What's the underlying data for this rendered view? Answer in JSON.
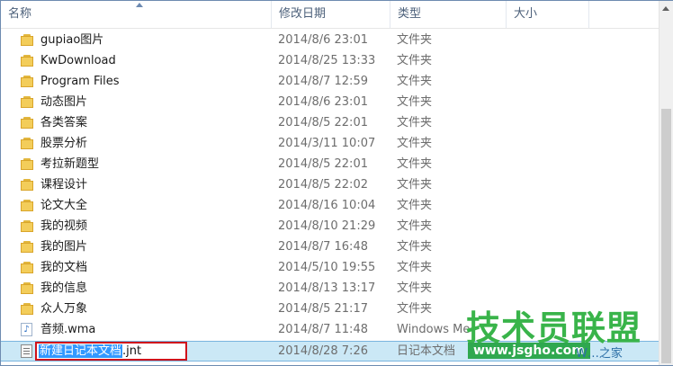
{
  "columns": {
    "name": "名称",
    "date": "修改日期",
    "type": "类型",
    "size": "大小"
  },
  "files": [
    {
      "icon": "folder",
      "name": "gupiao图片",
      "date": "2014/8/6 23:01",
      "type": "文件夹"
    },
    {
      "icon": "folder",
      "name": "KwDownload",
      "date": "2014/8/25 13:33",
      "type": "文件夹"
    },
    {
      "icon": "folder",
      "name": "Program Files",
      "date": "2014/8/7 12:59",
      "type": "文件夹"
    },
    {
      "icon": "folder",
      "name": "动态图片",
      "date": "2014/8/6 23:01",
      "type": "文件夹"
    },
    {
      "icon": "folder",
      "name": "各类答案",
      "date": "2014/8/5 22:01",
      "type": "文件夹"
    },
    {
      "icon": "folder",
      "name": "股票分析",
      "date": "2014/3/11 10:07",
      "type": "文件夹"
    },
    {
      "icon": "folder",
      "name": "考拉新题型",
      "date": "2014/8/5 22:01",
      "type": "文件夹"
    },
    {
      "icon": "folder",
      "name": "课程设计",
      "date": "2014/8/5 22:02",
      "type": "文件夹"
    },
    {
      "icon": "folder",
      "name": "论文大全",
      "date": "2014/8/16 10:04",
      "type": "文件夹"
    },
    {
      "icon": "folder",
      "name": "我的视频",
      "date": "2014/8/10 21:29",
      "type": "文件夹"
    },
    {
      "icon": "folder",
      "name": "我的图片",
      "date": "2014/8/7 16:48",
      "type": "文件夹"
    },
    {
      "icon": "folder",
      "name": "我的文档",
      "date": "2014/5/10 19:55",
      "type": "文件夹"
    },
    {
      "icon": "folder",
      "name": "我的信息",
      "date": "2014/8/13 13:17",
      "type": "文件夹"
    },
    {
      "icon": "folder",
      "name": "众人万象",
      "date": "2014/8/5 21:17",
      "type": "文件夹"
    },
    {
      "icon": "music",
      "name": "音频.wma",
      "date": "2014/8/7 11:48",
      "type": "Windows Me"
    }
  ],
  "selected_file": {
    "icon": "notepad",
    "rename_selected": "新建日记本文档",
    "rename_rest": ".jnt",
    "date": "2014/8/28 7:26",
    "type": "日记本文档"
  },
  "watermark": {
    "main": "技术员联盟",
    "url": "www.jsgho.com",
    "tag": "W…之家"
  },
  "colors": {
    "header_text": "#4c607a",
    "selection": "#cbe8f6",
    "rename_border": "#d0121b",
    "watermark_green": "#39b44a"
  }
}
